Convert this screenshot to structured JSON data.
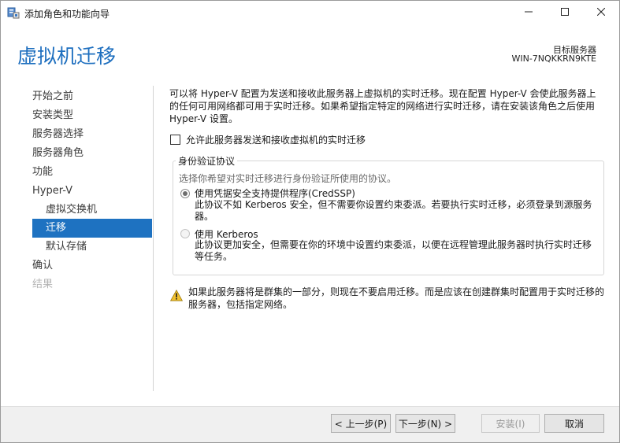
{
  "window": {
    "title": "添加角色和功能向导",
    "controls": {
      "minimize_icon": "minimize-icon",
      "maximize_icon": "maximize-icon",
      "close_icon": "close-icon"
    }
  },
  "header": {
    "page_title": "虚拟机迁移",
    "destination_label": "目标服务器",
    "destination_value": "WIN-7NQKKRN9KTE"
  },
  "sidebar": {
    "items": [
      {
        "label": "开始之前",
        "state": "normal"
      },
      {
        "label": "安装类型",
        "state": "normal"
      },
      {
        "label": "服务器选择",
        "state": "normal"
      },
      {
        "label": "服务器角色",
        "state": "normal"
      },
      {
        "label": "功能",
        "state": "normal"
      },
      {
        "label": "Hyper-V",
        "state": "normal"
      },
      {
        "label": "虚拟交换机",
        "state": "sub"
      },
      {
        "label": "迁移",
        "state": "active"
      },
      {
        "label": "默认存储",
        "state": "sub"
      },
      {
        "label": "确认",
        "state": "normal"
      },
      {
        "label": "结果",
        "state": "disabled"
      }
    ]
  },
  "main": {
    "intro": "可以将 Hyper-V 配置为发送和接收此服务器上虚拟机的实时迁移。现在配置 Hyper-V 会使此服务器上的任何可用网络都可用于实时迁移。如果希望指定特定的网络进行实时迁移，请在安装该角色之后使用 Hyper-V 设置。",
    "allow_checkbox": {
      "label": "允许此服务器发送和接收虚拟机的实时迁移",
      "checked": false
    },
    "auth_group": {
      "legend": "身份验证协议",
      "hint": "选择你希望对实时迁移进行身份验证所使用的协议。",
      "options": [
        {
          "title": "使用凭据安全支持提供程序(CredSSP)",
          "description": "此协议不如 Kerberos 安全，但不需要你设置约束委派。若要执行实时迁移，必须登录到源服务器。",
          "selected": true
        },
        {
          "title": "使用 Kerberos",
          "description": "此协议更加安全，但需要在你的环境中设置约束委派，以便在远程管理此服务器时执行实时迁移等任务。",
          "selected": false
        }
      ]
    },
    "warning": "如果此服务器将是群集的一部分，则现在不要启用迁移。而是应该在创建群集时配置用于实时迁移的服务器，包括指定网络。",
    "warning_icon": "warning-icon"
  },
  "footer": {
    "prev_label": "< 上一步(P)",
    "next_label": "下一步(N) >",
    "install_label": "安装(I)",
    "cancel_label": "取消"
  },
  "colors": {
    "accent": "#1e72c1",
    "title_blue": "#1e6fbf",
    "footer_bg": "#f0f0f0"
  }
}
